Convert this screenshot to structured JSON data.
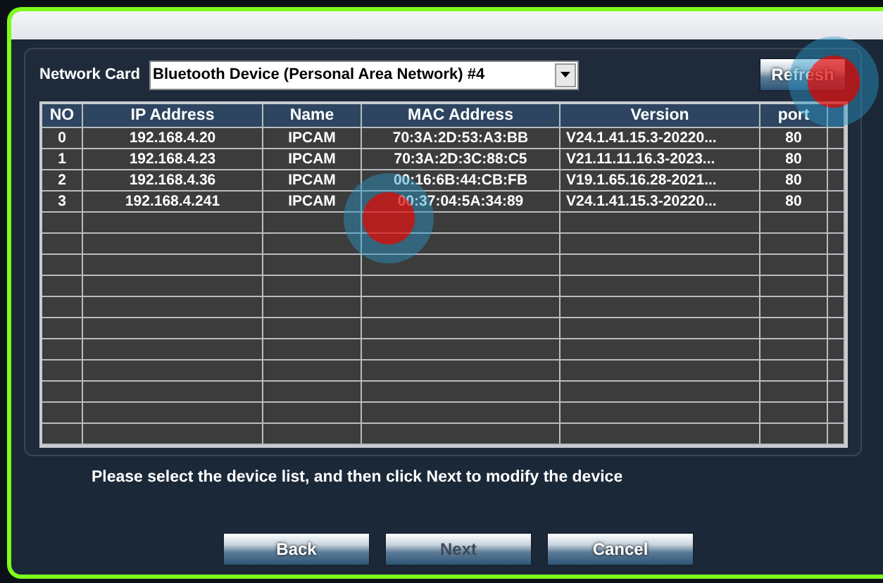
{
  "network_card": {
    "label": "Network Card",
    "value": "Bluetooth Device (Personal Area Network) #4"
  },
  "refresh_button": {
    "label": "Refresh",
    "disabled": false
  },
  "table": {
    "columns": [
      "NO",
      "IP Address",
      "Name",
      "MAC Address",
      "Version",
      "port"
    ],
    "rows": [
      {
        "cells": [
          "0",
          "192.168.4.20",
          "IPCAM",
          "70:3A:2D:53:A3:BB",
          "V24.1.41.15.3-20220...",
          "80"
        ]
      },
      {
        "cells": [
          "1",
          "192.168.4.23",
          "IPCAM",
          "70:3A:2D:3C:88:C5",
          "V21.11.11.16.3-2023...",
          "80"
        ]
      },
      {
        "cells": [
          "2",
          "192.168.4.36",
          "IPCAM",
          "00:16:6B:44:CB:FB",
          "V19.1.65.16.28-2021...",
          "80"
        ]
      },
      {
        "cells": [
          "3",
          "192.168.4.241",
          "IPCAM",
          "00:37:04:5A:34:89",
          "V24.1.41.15.3-20220...",
          "80"
        ]
      }
    ]
  },
  "hint": "Please select the device list, and then click Next to modify the device",
  "buttons": [
    {
      "label": "Back",
      "disabled": false
    },
    {
      "label": "Next",
      "disabled": true
    },
    {
      "label": "Cancel",
      "disabled": false
    }
  ]
}
